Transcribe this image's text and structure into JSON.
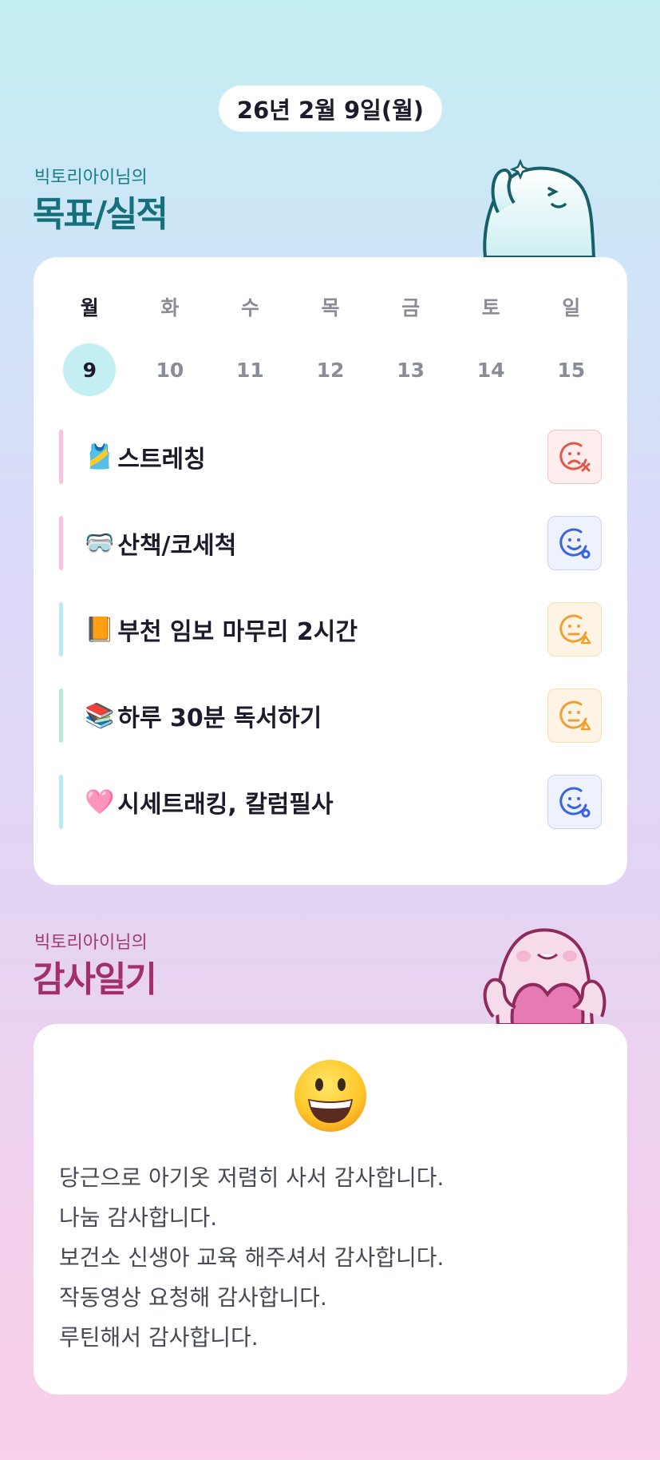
{
  "header": {
    "date": "26년 2월 9일(월)"
  },
  "goals_section": {
    "subtitle": "빅토리아이님의",
    "title": "목표/실적"
  },
  "week": {
    "days": [
      "월",
      "화",
      "수",
      "목",
      "금",
      "토",
      "일"
    ],
    "dates": [
      "9",
      "10",
      "11",
      "12",
      "13",
      "14",
      "15"
    ],
    "selected_index": 0
  },
  "goals": [
    {
      "emoji": "🎽",
      "label": "스트레칭",
      "bar_color": "#f7c2de",
      "status": "failed",
      "status_icon": "sad-x-icon",
      "status_color": "#e2574c"
    },
    {
      "emoji": "🥽",
      "label": "산책/코세척",
      "bar_color": "#f7c2de",
      "status": "done",
      "status_icon": "smile-o-icon",
      "status_color": "#3a63e0"
    },
    {
      "emoji": "📙",
      "label": "부천 임보 마무리 2시간",
      "bar_color": "#b9ecf0",
      "status": "partial",
      "status_icon": "neutral-triangle-icon",
      "status_color": "#f0a030"
    },
    {
      "emoji": "📚",
      "label": " 하루 30분 독서하기",
      "bar_color": "#b8ecd8",
      "status": "partial",
      "status_icon": "neutral-triangle-icon",
      "status_color": "#f0a030"
    },
    {
      "emoji": "🩷",
      "label": " 시세트래킹, 칼럼필사",
      "bar_color": "#b9ecf0",
      "status": "done",
      "status_icon": "smile-o-icon",
      "status_color": "#3a63e0"
    }
  ],
  "gratitude_section": {
    "subtitle": "빅토리아이님의",
    "title": "감사일기",
    "mood_icon": "grinning-face-icon",
    "lines": [
      "당근으로 아기옷 저렴히 사서 감사합니다.",
      "나눔 감사합니다.",
      "보건소 신생아 교육 해주셔서 감사합니다.",
      "작동영상 요청해 감사합니다.",
      "루틴해서 감사합니다."
    ]
  },
  "colors": {
    "accent_teal": "#14707a",
    "accent_pink": "#a22f6a",
    "selected_date_bg": "#c3eff3"
  }
}
